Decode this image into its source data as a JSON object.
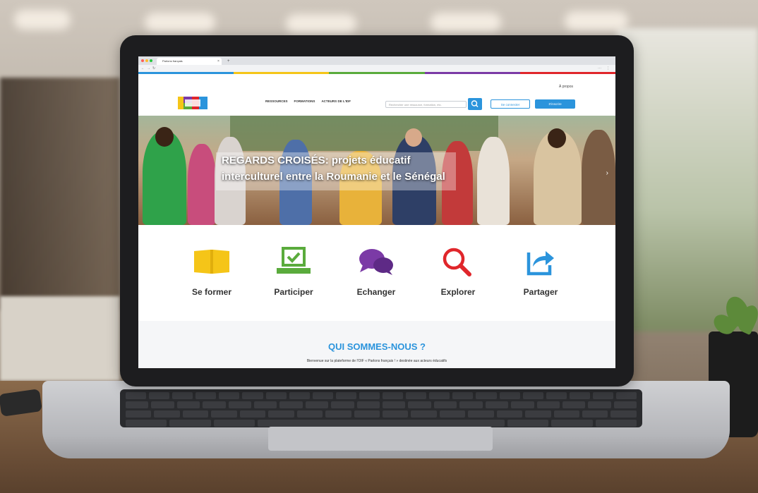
{
  "browser": {
    "tab_title": "Parlons français"
  },
  "site": {
    "top_link": "À propos",
    "nav": [
      "RESSOURCES",
      "FORMATIONS",
      "ACTEURS DE L'IDF"
    ],
    "search_placeholder": "Rechercher une ressource, formation, etc.",
    "login_button": "Se connecter",
    "register_button": "S'inscrire"
  },
  "hero": {
    "title_line1": "REGARDS CROISÉS: projets éducatif",
    "title_line2": "interculturel entre la Roumanie et le Sénégal"
  },
  "features": [
    {
      "label": "Se former",
      "icon": "book-icon",
      "color": "#f5c518"
    },
    {
      "label": "Participer",
      "icon": "ballot-check-icon",
      "color": "#5aab3c"
    },
    {
      "label": "Echanger",
      "icon": "chat-bubbles-icon",
      "color": "#7b3aa6"
    },
    {
      "label": "Explorer",
      "icon": "magnifier-icon",
      "color": "#e0262b"
    },
    {
      "label": "Partager",
      "icon": "share-icon",
      "color": "#2b94dc"
    }
  ],
  "about": {
    "title": "QUI SOMMES-NOUS ?",
    "text": "Bienvenue sur la plateforme de l'OIF « Parlons français ! » destinée aux acteurs éducatifs"
  },
  "colors": {
    "accent": "#2b94dc",
    "stripe": [
      "#2b94dc",
      "#f5c518",
      "#5aab3c",
      "#7b3aa6",
      "#e0262b"
    ]
  }
}
